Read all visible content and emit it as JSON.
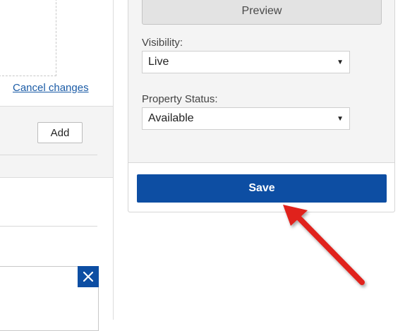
{
  "left": {
    "cancel_link": "Cancel changes",
    "add_button": "Add"
  },
  "card": {
    "preview_button": "Preview",
    "visibility": {
      "label": "Visibility:",
      "value": "Live"
    },
    "property_status": {
      "label": "Property Status:",
      "value": "Available"
    },
    "save_button": "Save"
  },
  "colors": {
    "primary": "#0d4ea3",
    "annotation_arrow": "#e0201e",
    "link": "#1a5ba6"
  }
}
